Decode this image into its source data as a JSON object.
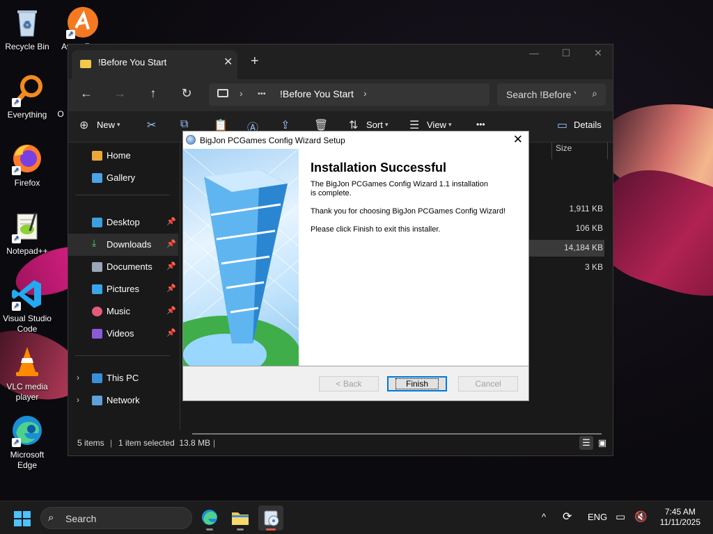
{
  "desktop": {
    "icons": [
      {
        "label": "Recycle Bin"
      },
      {
        "label": "Avast Free Antivirus"
      },
      {
        "label": "Everything"
      },
      {
        "label": "O"
      },
      {
        "label": "Firefox"
      },
      {
        "label": "Notepad++"
      },
      {
        "label": "Visual Studio Code"
      },
      {
        "label": "VLC media player"
      },
      {
        "label": "Microsoft Edge"
      }
    ]
  },
  "explorer": {
    "tab_title": "!Before You Start",
    "address": {
      "more": "•••",
      "crumb": "!Before You Start"
    },
    "search_placeholder": "Search !Before You Start",
    "commands": {
      "new": "New",
      "sort": "Sort",
      "view": "View",
      "more": "•••",
      "details": "Details"
    },
    "nav": {
      "quick": [
        "Home",
        "Gallery"
      ],
      "pinned": [
        "Desktop",
        "Downloads",
        "Documents",
        "Pictures",
        "Music",
        "Videos"
      ],
      "tree": [
        "This PC",
        "Network"
      ]
    },
    "column_size": "Size",
    "sizes": [
      "1,911 KB",
      "106 KB",
      "14,184 KB",
      "3 KB"
    ],
    "status": {
      "items": "5 items",
      "selected": "1 item selected  13.8 MB"
    }
  },
  "wizard": {
    "title": "BigJon PCGames Config Wizard Setup",
    "heading": "Installation Successful",
    "line1": "The BigJon PCGames Config Wizard 1.1 installation is complete.",
    "line2": "Thank you for choosing BigJon PCGames Config Wizard!",
    "line3": "Please click Finish to exit this installer.",
    "buttons": {
      "back": "< Back",
      "finish": "Finish",
      "cancel": "Cancel"
    }
  },
  "taskbar": {
    "search_label": "Search",
    "language": "ENG",
    "time": "7:45 AM",
    "date": "11/11/2025"
  },
  "colors": {
    "accent": "#0078d7",
    "taskbar": "#1c1c1c",
    "explorer_bg": "#191919"
  }
}
